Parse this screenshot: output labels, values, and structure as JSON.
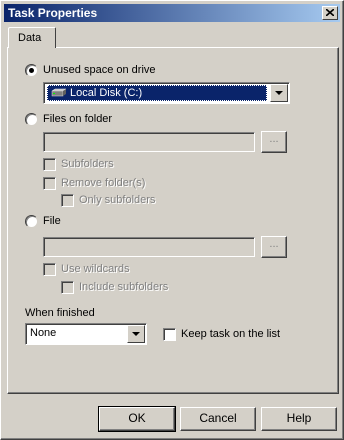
{
  "window": {
    "title": "Task Properties"
  },
  "tabs": [
    {
      "label": "Data"
    }
  ],
  "source": {
    "unused_space_label": "Unused space on drive",
    "drive_selected": "Local Disk (C:)",
    "files_on_folder_label": "Files on folder",
    "folder_value": "",
    "browse_label": "...",
    "subfolders_label": "Subfolders",
    "remove_folders_label": "Remove folder(s)",
    "only_subfolders_label": "Only subfolders",
    "file_label": "File",
    "file_value": "",
    "use_wildcards_label": "Use wildcards",
    "include_subfolders_label": "Include subfolders"
  },
  "finished": {
    "label": "When finished",
    "selected": "None",
    "keep_task_label": "Keep task on the list"
  },
  "buttons": {
    "ok": "OK",
    "cancel": "Cancel",
    "help": "Help"
  },
  "icons": {
    "close": "close-icon",
    "drive": "hard-drive-icon"
  },
  "colors": {
    "titlebar": "#0a246a",
    "selection": "#0a246a",
    "face": "#d4d0c8"
  }
}
